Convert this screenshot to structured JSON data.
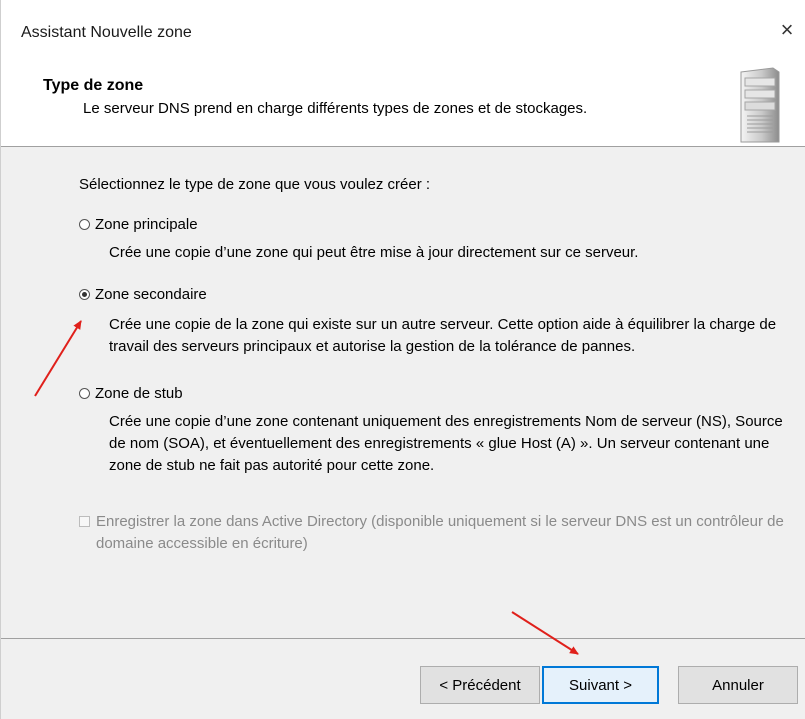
{
  "window": {
    "title": "Assistant Nouvelle zone",
    "close_glyph": "×"
  },
  "header": {
    "title": "Type de zone",
    "subtitle": "Le serveur DNS prend en charge différents types de zones et de stockages.",
    "icon": "server-icon"
  },
  "main": {
    "prompt": "Sélectionnez le type de zone que vous voulez créer :",
    "options": [
      {
        "label": "Zone principale",
        "checked": false,
        "description": "Crée une copie d’une zone qui peut être mise à jour directement sur ce serveur."
      },
      {
        "label": "Zone secondaire",
        "checked": true,
        "description": "Crée une copie de la zone qui existe sur un autre serveur. Cette option aide à équilibrer la charge de travail des serveurs principaux et autorise la gestion de la tolérance de pannes."
      },
      {
        "label": "Zone de stub",
        "checked": false,
        "description": "Crée une copie d’une zone contenant uniquement des enregistrements Nom de serveur (NS), Source de nom (SOA), et éventuellement des enregistrements « glue Host (A) ». Un serveur contenant une zone de stub ne fait pas autorité pour cette zone."
      }
    ],
    "ad_checkbox": {
      "label": "Enregistrer la zone dans Active Directory (disponible uniquement si le serveur DNS est un contrôleur de domaine accessible en écriture)",
      "checked": false,
      "enabled": false
    }
  },
  "footer": {
    "back_label": "< Précédent",
    "next_label": "Suivant >",
    "cancel_label": "Annuler"
  },
  "colors": {
    "accent": "#0078d7",
    "annotation": "#e0201b"
  }
}
